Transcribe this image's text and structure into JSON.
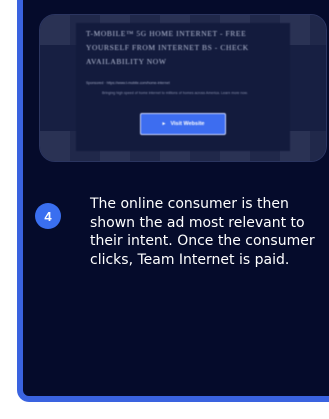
{
  "ad": {
    "title": "T-Mobile™ 5G Home Internet - Free Yourself from Internet BS - Check Availability Now",
    "sponsored": "Sponsored · https://www.t-mobile.com/home-internet",
    "description": "Bringing high speed of home internet to millions of homes across America. Learn more now.",
    "button_label": "Visit Website"
  },
  "step": {
    "number": "4",
    "text": "The online consumer is then shown the ad most relevant to their intent. Once the consumer clicks, Team Internet is paid."
  },
  "colors": {
    "card_bg": "#050b2b",
    "accent": "#3a63e0",
    "badge": "#3a6ff0"
  }
}
